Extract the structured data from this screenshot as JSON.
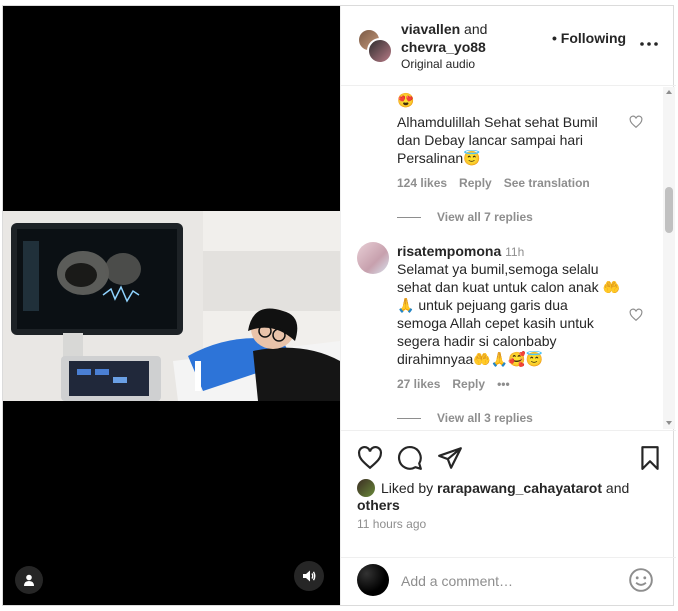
{
  "header": {
    "user1": "viavallen",
    "conj": "and",
    "user2": "chevra_yo88",
    "audio": "Original audio",
    "follow_state": "• Following"
  },
  "comments": [
    {
      "emoji_prefix": "😍",
      "text_line1": "Alhamdulillah Sehat sehat Bumil",
      "text_line2": "dan Debay lancar sampai hari",
      "text_line3": "Persalinan😇",
      "likes": "124 likes",
      "reply": "Reply",
      "translate": "See translation",
      "view_replies": "View all 7 replies"
    },
    {
      "user": "risatempomona",
      "time": "11h",
      "text_line1": "Selamat ya bumil,semoga selalu",
      "text_line2": "sehat dan kuat untuk calon anak 🤲",
      "text_line3": "🙏 untuk pejuang garis dua",
      "text_line4": "semoga Allah cepet kasih untuk",
      "text_line5": "segera hadir si calonbaby",
      "text_line6": "dirahimnyaa🤲🙏🥰😇",
      "likes": "27 likes",
      "reply": "Reply",
      "more": "•••",
      "view_replies": "View all 3 replies"
    }
  ],
  "likes": {
    "prefix": "Liked by",
    "user": "rarapawang_cahayatarot",
    "and": "and",
    "others": "others",
    "timestamp": "11 hours ago"
  },
  "add_comment": {
    "placeholder": "Add a comment…"
  },
  "icons": {
    "like": "heart-icon",
    "comment": "comment-icon",
    "share": "send-icon",
    "save": "bookmark-icon",
    "emoji": "emoji-icon",
    "audio": "speaker-icon",
    "tag": "user-tag-icon"
  }
}
